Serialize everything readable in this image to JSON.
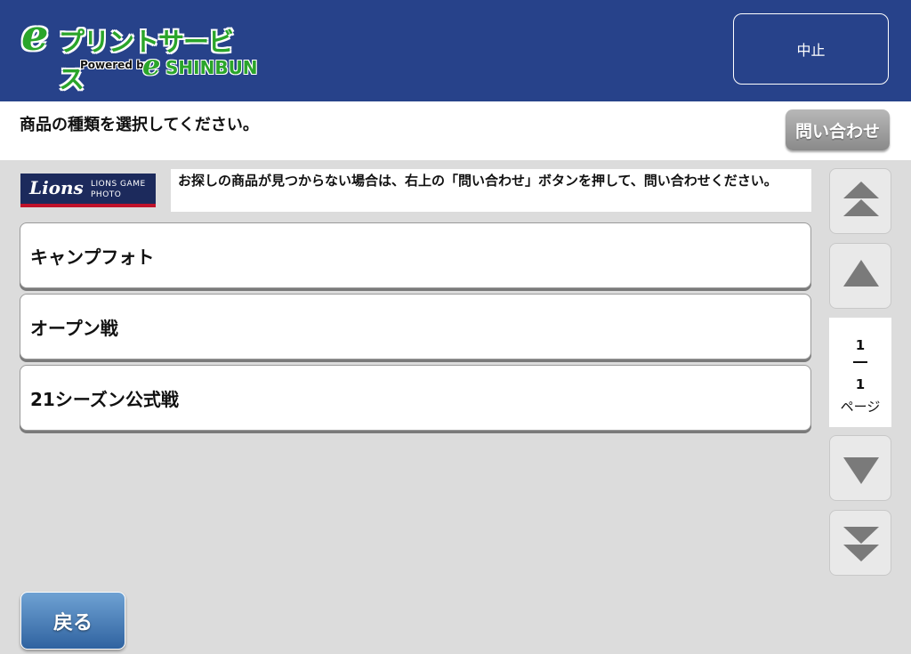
{
  "header": {
    "logo": {
      "title": "プリントサービス",
      "e_letter": "e",
      "powered_by": "Powered by",
      "brand": "SHINBUN"
    },
    "cancel_label": "中止",
    "colors": {
      "header_bg": "#27428a",
      "logo_green": "#2aa52a"
    }
  },
  "instruction": {
    "text": "商品の種類を選択してください。",
    "inquiry_label": "問い合わせ"
  },
  "brand_banner": {
    "logo_text": "Lions",
    "sub_line1": "LIONS GAME",
    "sub_line2": "PHOTO"
  },
  "notice": "お探しの商品が見つからない場合は、右上の「問い合わせ」ボタンを押して、問い合わせください。",
  "products": [
    {
      "label": "キャンプフォト"
    },
    {
      "label": "オープン戦"
    },
    {
      "label": "21シーズン公式戦"
    }
  ],
  "pager": {
    "current_page": "1",
    "total_pages": "1",
    "unit": "ページ",
    "icons": [
      "first-page-icon",
      "prev-page-icon",
      "next-page-icon",
      "last-page-icon"
    ]
  },
  "footer": {
    "back_label": "戻る"
  }
}
